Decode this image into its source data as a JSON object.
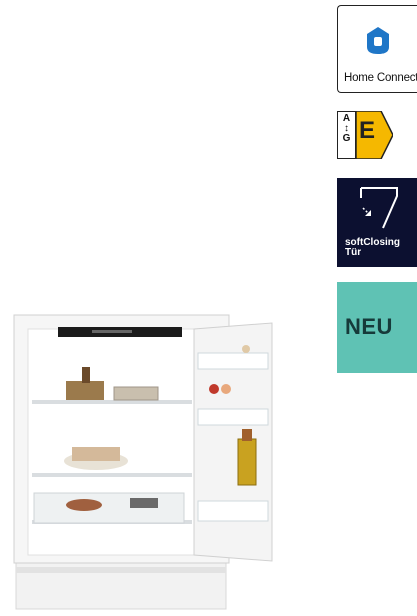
{
  "badges": {
    "home_connect": {
      "label": "Home Connect",
      "icon": "home-connect-icon"
    },
    "energy_label": {
      "scale_top": "A",
      "scale_bottom": "G",
      "class": "E",
      "color": "#f5b800"
    },
    "soft_closing": {
      "label_line1": "softClosing",
      "label_line2": "Tür",
      "icon": "soft-close-door-icon"
    },
    "new": {
      "label": "NEU",
      "color": "#5fc2b4"
    }
  },
  "product": {
    "image": "built-in-fridge-open-door"
  }
}
